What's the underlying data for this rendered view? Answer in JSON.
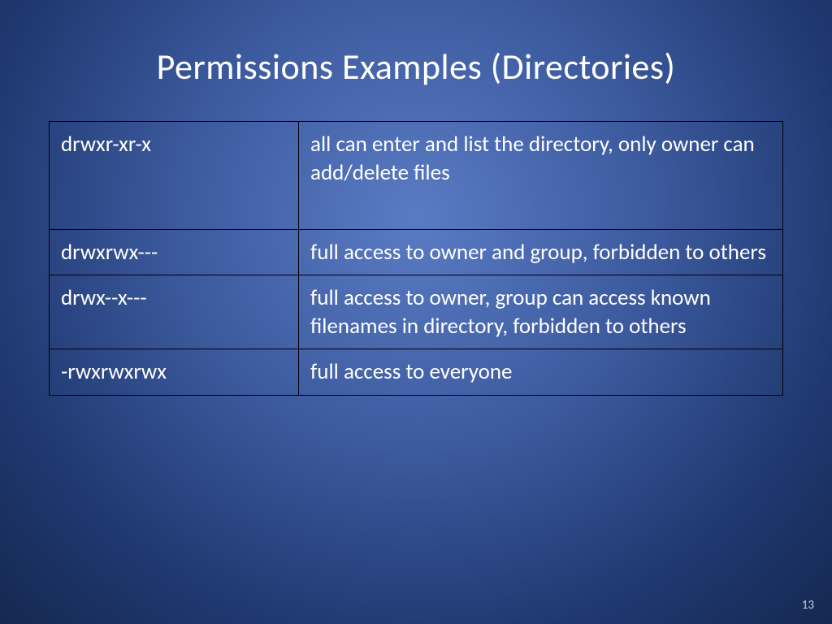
{
  "slide": {
    "title": "Permissions Examples (Directories)",
    "page_number": "13"
  },
  "table": {
    "rows": [
      {
        "permission": "drwxr-xr-x",
        "description": "all can enter and list the directory, only owner can add/delete files"
      },
      {
        "permission": "drwxrwx---",
        "description": "full access to owner and group, forbidden to others"
      },
      {
        "permission": "drwx--x---",
        "description": "full access to owner, group can access known filenames in directory, forbidden to others"
      },
      {
        "permission": "-rwxrwxrwx",
        "description": "full access to everyone"
      }
    ]
  }
}
